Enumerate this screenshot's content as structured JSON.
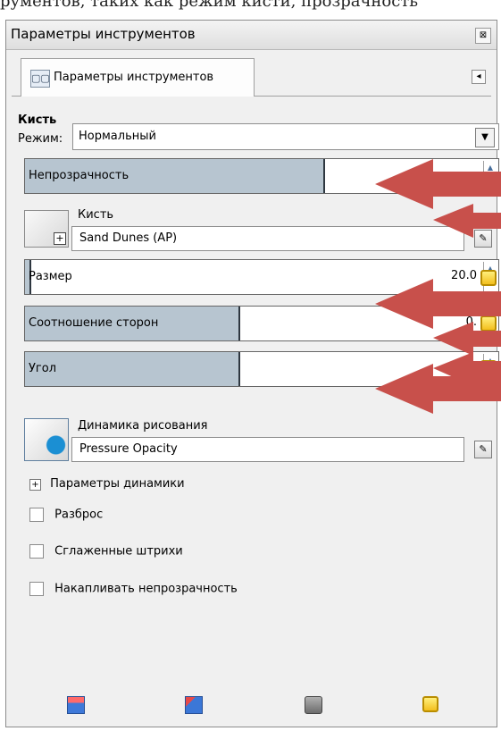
{
  "document_fragment": "рументов, таких как режим кисти, прозрачность",
  "window": {
    "title": "Параметры инструментов",
    "close_symbol": "⊠"
  },
  "tab": {
    "label": "Параметры инструментов",
    "icon": "tool-options-icon"
  },
  "brush_section": {
    "title": "Кисть",
    "mode_label": "Режим:",
    "mode_value": "Нормальный"
  },
  "sliders": {
    "opacity": {
      "label": "Непрозрачность",
      "value": "",
      "fill_percent": 63
    },
    "size": {
      "label": "Размер",
      "value": "20.0",
      "fill_percent": 1
    },
    "aspect": {
      "label": "Соотношение сторон",
      "value": "0.",
      "fill_percent": 45
    },
    "angle": {
      "label": "Угол",
      "value": "0.",
      "fill_percent": 45
    }
  },
  "brush": {
    "label": "Кисть",
    "value": "Sand Dunes (AP)",
    "plus_symbol": "+"
  },
  "dynamics": {
    "label": "Динамика рисования",
    "value": "Pressure Opacity",
    "options_label": "Параметры динамики",
    "expander_symbol": "+"
  },
  "checkboxes": [
    {
      "label": "Разброс"
    },
    {
      "label": "Сглаженные штрихи"
    },
    {
      "label": "Накапливать непрозрачность"
    }
  ],
  "bottom_actions": [
    {
      "name": "save-options-icon"
    },
    {
      "name": "restore-options-icon"
    },
    {
      "name": "delete-options-icon"
    },
    {
      "name": "reset-options-icon"
    }
  ],
  "colors": {
    "slider_fill": "#b7c5d0",
    "arrow": "#c8504b"
  }
}
